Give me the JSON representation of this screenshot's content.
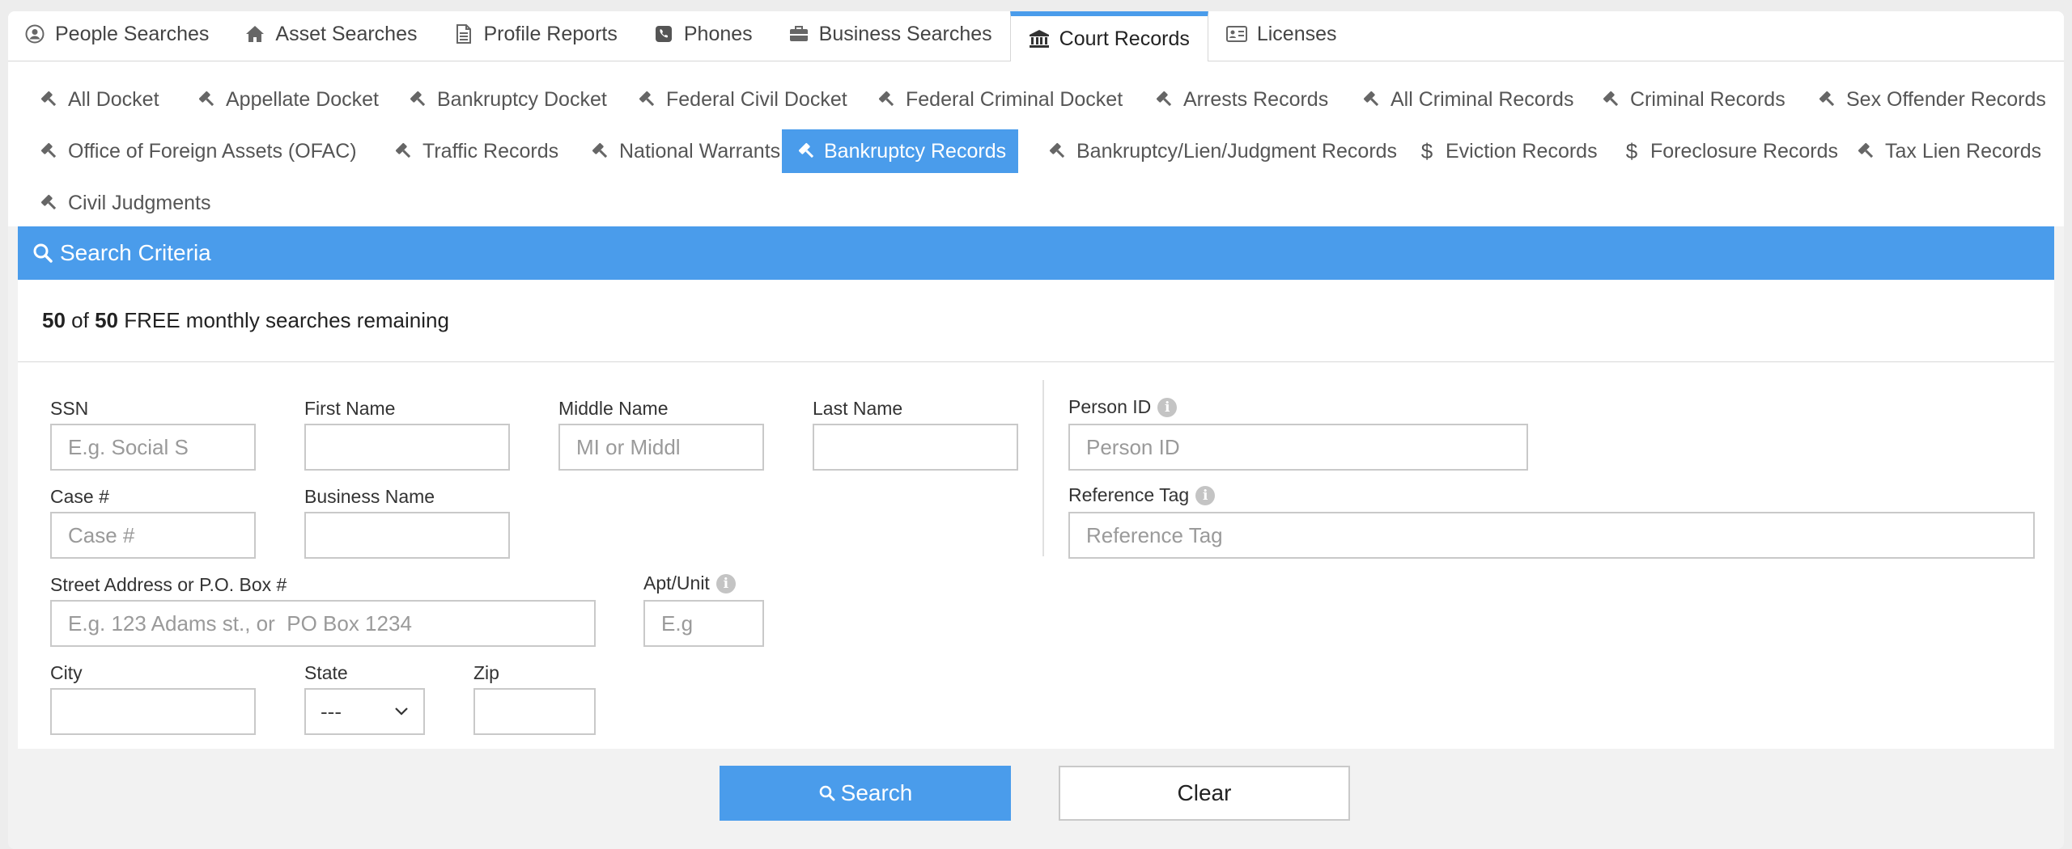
{
  "tabs": [
    {
      "label": "People Searches",
      "icon": "user-circle-icon"
    },
    {
      "label": "Asset Searches",
      "icon": "home-icon"
    },
    {
      "label": "Profile Reports",
      "icon": "document-icon"
    },
    {
      "label": "Phones",
      "icon": "phone-icon"
    },
    {
      "label": "Business Searches",
      "icon": "briefcase-icon"
    },
    {
      "label": "Court Records",
      "icon": "courthouse-icon",
      "active": true
    },
    {
      "label": "Licenses",
      "icon": "id-card-icon"
    }
  ],
  "subtabs": {
    "row1": [
      "All Docket",
      "Appellate Docket",
      "Bankruptcy Docket",
      "Federal Civil Docket",
      "Federal Criminal Docket",
      "Arrests Records",
      "All Criminal Records",
      "Criminal Records",
      "Sex Offender Records"
    ],
    "row2": [
      "Office of Foreign Assets (OFAC)",
      "Traffic Records",
      "National Warrants",
      "Bankruptcy Records",
      "Bankruptcy/Lien/Judgment Records",
      "Eviction Records",
      "Foreclosure Records",
      "Tax Lien Records"
    ],
    "row3": [
      "Civil Judgments"
    ],
    "active": "Bankruptcy Records",
    "dollar_icon_items": [
      "Eviction Records",
      "Foreclosure Records"
    ]
  },
  "panel": {
    "title": "Search Criteria",
    "quota": {
      "used": "50",
      "of": "of",
      "total": "50",
      "text": "FREE monthly searches remaining"
    }
  },
  "form": {
    "ssn": {
      "label": "SSN",
      "placeholder": "E.g. Social S"
    },
    "first_name": {
      "label": "First Name",
      "placeholder": ""
    },
    "middle_name": {
      "label": "Middle Name",
      "placeholder": "MI or Middl"
    },
    "last_name": {
      "label": "Last Name",
      "placeholder": ""
    },
    "person_id": {
      "label": "Person ID",
      "placeholder": "Person ID"
    },
    "case_no": {
      "label": "Case #",
      "placeholder": "Case #"
    },
    "business_name": {
      "label": "Business Name",
      "placeholder": ""
    },
    "reference_tag": {
      "label": "Reference Tag",
      "placeholder": "Reference Tag"
    },
    "street": {
      "label": "Street Address or P.O. Box #",
      "placeholder": "E.g. 123 Adams st., or  PO Box 1234"
    },
    "apt": {
      "label": "Apt/Unit",
      "placeholder": "E.g"
    },
    "city": {
      "label": "City",
      "placeholder": ""
    },
    "state": {
      "label": "State",
      "value": "---"
    },
    "zip": {
      "label": "Zip",
      "placeholder": ""
    }
  },
  "buttons": {
    "search": "Search",
    "clear": "Clear"
  },
  "colors": {
    "accent": "#4a9ceb",
    "panel_bg": "#ffffff",
    "page_bg": "#f2f2f2"
  }
}
